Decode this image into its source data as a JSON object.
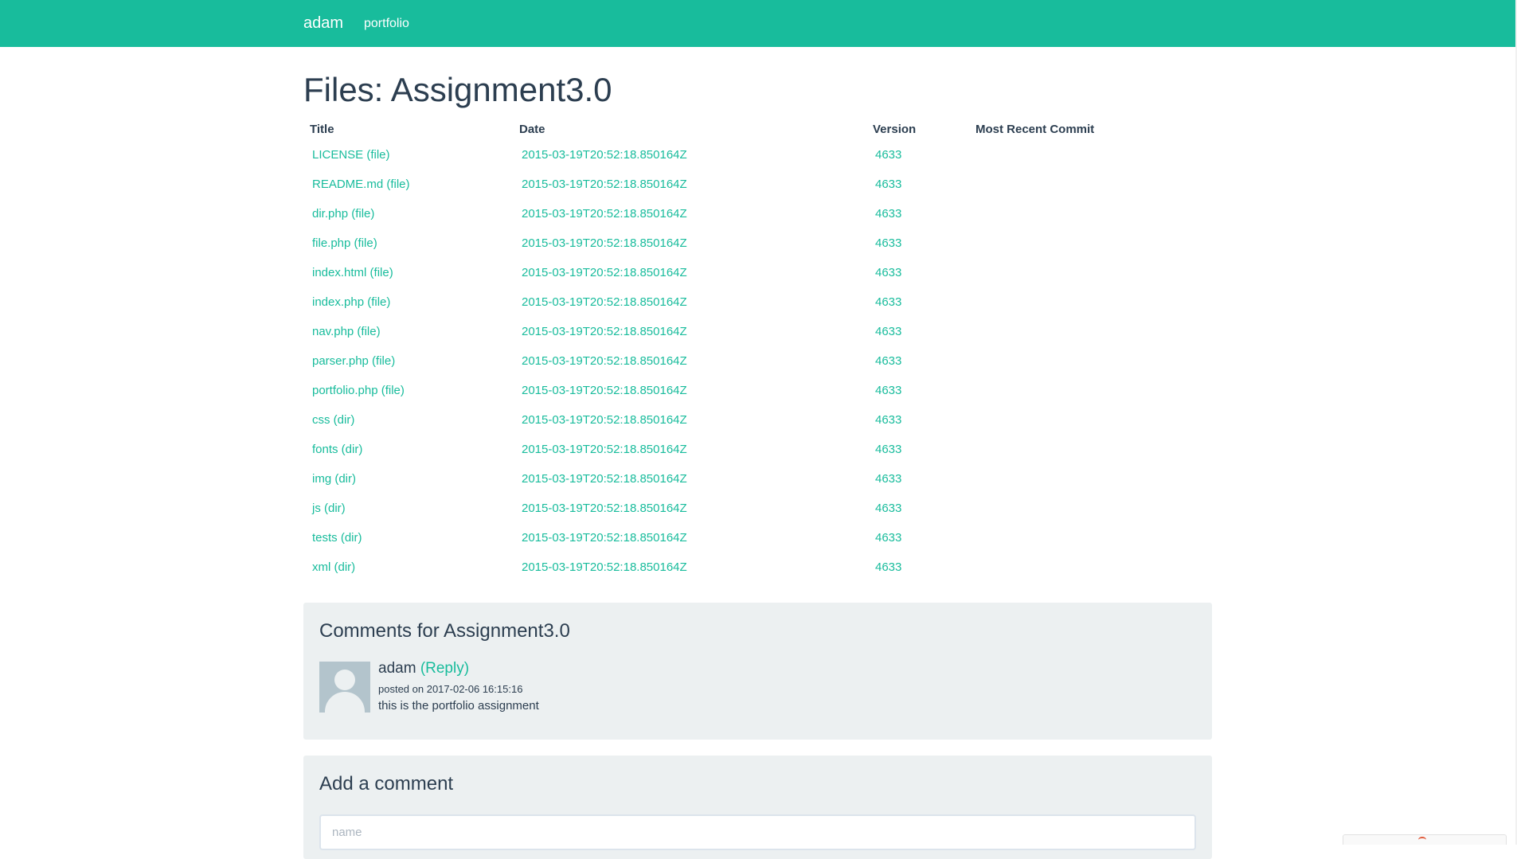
{
  "nav": {
    "brand": "adam",
    "links": [
      "portfolio"
    ]
  },
  "page": {
    "title": "Files: Assignment3.0"
  },
  "files_table": {
    "headers": [
      "Title",
      "Date",
      "Version",
      "Most Recent Commit"
    ],
    "rows": [
      {
        "title": "LICENSE (file)",
        "date": "2015-03-19T20:52:18.850164Z",
        "version": "4633",
        "commit": ""
      },
      {
        "title": "README.md (file)",
        "date": "2015-03-19T20:52:18.850164Z",
        "version": "4633",
        "commit": ""
      },
      {
        "title": "dir.php (file)",
        "date": "2015-03-19T20:52:18.850164Z",
        "version": "4633",
        "commit": ""
      },
      {
        "title": "file.php (file)",
        "date": "2015-03-19T20:52:18.850164Z",
        "version": "4633",
        "commit": ""
      },
      {
        "title": "index.html (file)",
        "date": "2015-03-19T20:52:18.850164Z",
        "version": "4633",
        "commit": ""
      },
      {
        "title": "index.php (file)",
        "date": "2015-03-19T20:52:18.850164Z",
        "version": "4633",
        "commit": ""
      },
      {
        "title": "nav.php (file)",
        "date": "2015-03-19T20:52:18.850164Z",
        "version": "4633",
        "commit": ""
      },
      {
        "title": "parser.php (file)",
        "date": "2015-03-19T20:52:18.850164Z",
        "version": "4633",
        "commit": ""
      },
      {
        "title": "portfolio.php (file)",
        "date": "2015-03-19T20:52:18.850164Z",
        "version": "4633",
        "commit": ""
      },
      {
        "title": "css (dir)",
        "date": "2015-03-19T20:52:18.850164Z",
        "version": "4633",
        "commit": ""
      },
      {
        "title": "fonts (dir)",
        "date": "2015-03-19T20:52:18.850164Z",
        "version": "4633",
        "commit": ""
      },
      {
        "title": "img (dir)",
        "date": "2015-03-19T20:52:18.850164Z",
        "version": "4633",
        "commit": ""
      },
      {
        "title": "js (dir)",
        "date": "2015-03-19T20:52:18.850164Z",
        "version": "4633",
        "commit": ""
      },
      {
        "title": "tests (dir)",
        "date": "2015-03-19T20:52:18.850164Z",
        "version": "4633",
        "commit": ""
      },
      {
        "title": "xml (dir)",
        "date": "2015-03-19T20:52:18.850164Z",
        "version": "4633",
        "commit": ""
      }
    ]
  },
  "comments": {
    "heading": "Comments for Assignment3.0",
    "items": [
      {
        "author": "adam",
        "reply_label": "(Reply)",
        "meta": "posted on 2017-02-06 16:15:16",
        "text": "this is the portfolio assignment",
        "avatar_icon": "default-user-avatar"
      }
    ]
  },
  "add_comment": {
    "heading": "Add a comment",
    "name_placeholder": "name"
  },
  "colors": {
    "accent": "#18bc9c",
    "text": "#2c3e50",
    "panel": "#ecf0f1"
  }
}
